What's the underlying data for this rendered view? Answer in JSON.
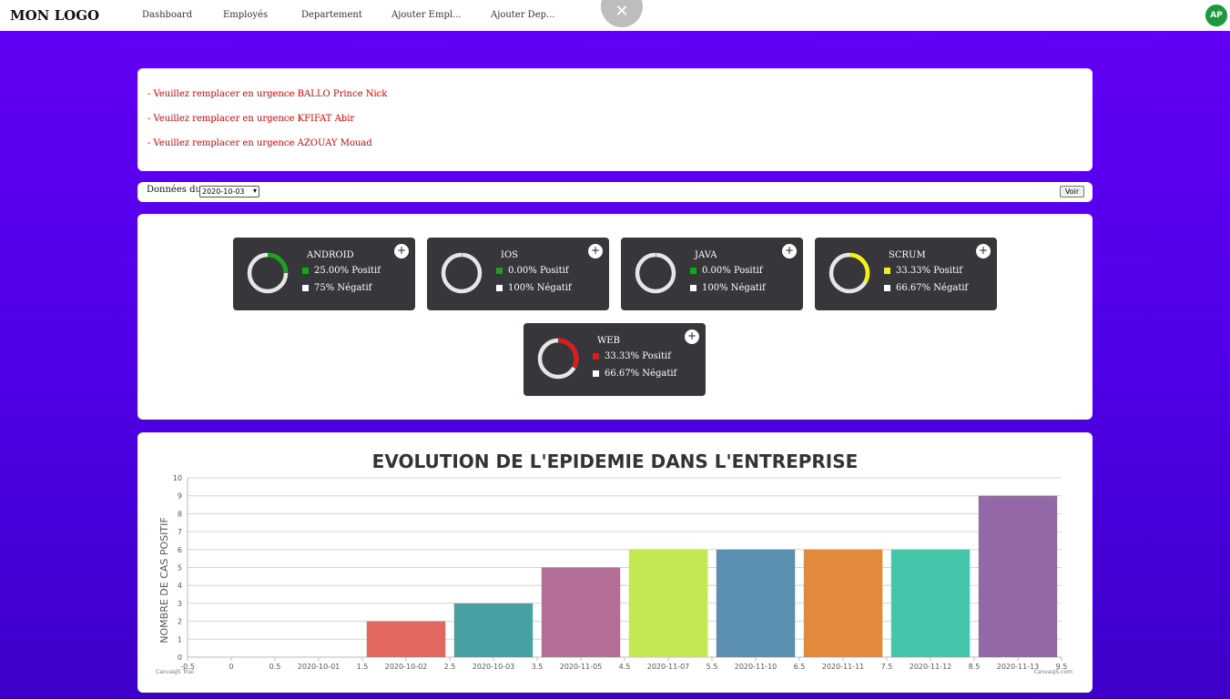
{
  "nav": {
    "logo": "MON LOGO",
    "links": [
      "Dashboard",
      "Employés",
      "Departement",
      "Ajouter Empl...",
      "Ajouter Dep..."
    ],
    "close_symbol": "✕",
    "avatar_initials": "AP"
  },
  "alerts": [
    "- Veuillez remplacer en urgence BALLO Prince Nick",
    "- Veuillez remplacer en urgence KFIFAT Abir",
    "- Veuillez remplacer en urgence AZOUAY Mouad"
  ],
  "filter": {
    "label": "Données du :",
    "selected_date": "2020-10-03",
    "button": "Voir"
  },
  "departments": [
    {
      "name": "ANDROID",
      "positive": 0.25,
      "positive_text": "25.00% Positif",
      "negative_text": "75% Négatif",
      "color": "#1aa31a"
    },
    {
      "name": "IOS",
      "positive": 0.0,
      "positive_text": "0.00% Positif",
      "negative_text": "100% Négatif",
      "color": "#1aa31a"
    },
    {
      "name": "JAVA",
      "positive": 0.0,
      "positive_text": "0.00% Positif",
      "negative_text": "100% Négatif",
      "color": "#1aa31a"
    },
    {
      "name": "SCRUM",
      "positive": 0.3333,
      "positive_text": "33.33% Positif",
      "negative_text": "66.67% Négatif",
      "color": "#f2f21a"
    },
    {
      "name": "WEB",
      "positive": 0.3333,
      "positive_text": "33.33% Positif",
      "negative_text": "66.67% Négatif",
      "color": "#e01a1a"
    }
  ],
  "chart_data": {
    "type": "bar",
    "title": "EVOLUTION DE L'EPIDEMIE DANS L'ENTREPRISE",
    "ylabel": "NOMBRE DE CAS POSITIF",
    "ylim": [
      0,
      10
    ],
    "x_ticks": [
      "-0.5",
      "0",
      "0.5",
      "2020-10-01",
      "1.5",
      "2020-10-02",
      "2.5",
      "2020-10-03",
      "3.5",
      "2020-11-05",
      "4.5",
      "2020-11-07",
      "5.5",
      "2020-11-10",
      "6.5",
      "2020-11-11",
      "7.5",
      "2020-11-12",
      "8.5",
      "2020-11-13",
      "9.5"
    ],
    "y_ticks": [
      "0",
      "1",
      "2",
      "3",
      "4",
      "5",
      "6",
      "7",
      "8",
      "9",
      "10"
    ],
    "categories": [
      "0",
      "2020-10-01",
      "2020-10-02",
      "2020-10-03",
      "2020-11-05",
      "2020-11-07",
      "2020-11-10",
      "2020-11-11",
      "2020-11-12",
      "2020-11-13"
    ],
    "values": [
      0,
      0,
      2,
      3,
      5,
      6,
      6,
      6,
      6,
      9
    ],
    "colors": [
      "#4f81bc",
      "#c0504e",
      "#e0685f",
      "#47a0a4",
      "#b36e96",
      "#c2e952",
      "#5a8fb0",
      "#e28a3c",
      "#45c6ab",
      "#9368a7"
    ],
    "grid": "horizontal",
    "watermark_left": "CanvasJS Trial",
    "watermark_right": "CanvasJS.com"
  }
}
